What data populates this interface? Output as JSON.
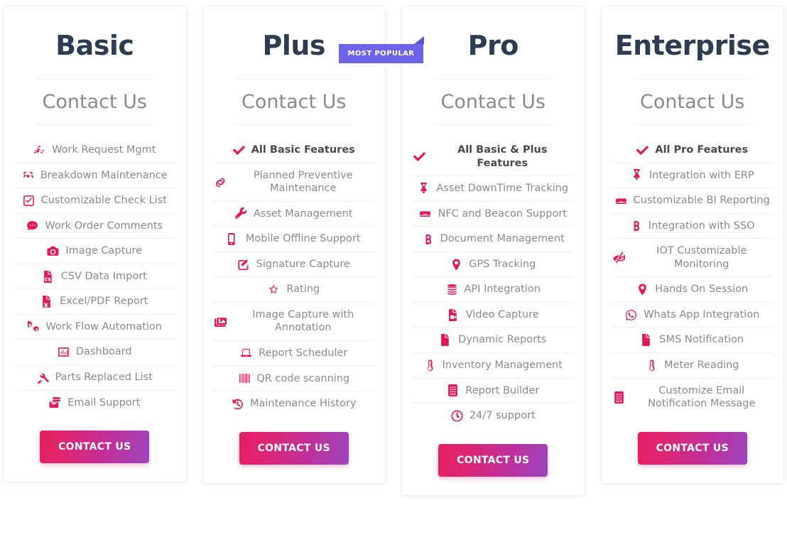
{
  "theme": {
    "accent_pink": "#e6175c",
    "badge_purple": "#6c63e8",
    "title_color": "#2e3c52",
    "muted_text": "#8b8b8f",
    "cta_gradient_from": "#e51f63",
    "cta_gradient_to": "#9b45bd"
  },
  "plans": [
    {
      "name": "Basic",
      "price_label": "Contact Us",
      "badge": null,
      "cta_label": "CONTACT US",
      "features": [
        {
          "label": "Work Request Mgmt",
          "icon": "cubes-icon",
          "headline": false
        },
        {
          "label": "Breakdown Maintenance",
          "icon": "broken-link-icon",
          "headline": false
        },
        {
          "label": "Customizable Check List",
          "icon": "check-square-icon",
          "headline": false
        },
        {
          "label": "Work Order Comments",
          "icon": "comment-dots-icon",
          "headline": false
        },
        {
          "label": "Image Capture",
          "icon": "camera-icon",
          "headline": false
        },
        {
          "label": "CSV Data Import",
          "icon": "file-csv-icon",
          "headline": false
        },
        {
          "label": "Excel/PDF Report",
          "icon": "file-excel-icon",
          "headline": false
        },
        {
          "label": "Work Flow Automation",
          "icon": "cogs-icon",
          "headline": false
        },
        {
          "label": "Dashboard",
          "icon": "chart-bar-icon",
          "headline": false
        },
        {
          "label": "Parts Replaced List",
          "icon": "wrench-screw-icon",
          "headline": false
        },
        {
          "label": "Email Support",
          "icon": "mail-bulk-icon",
          "headline": false
        }
      ]
    },
    {
      "name": "Plus",
      "price_label": "Contact Us",
      "badge": "MOST POPULAR",
      "cta_label": "CONTACT US",
      "features": [
        {
          "label": "All Basic Features",
          "icon": "check-icon",
          "headline": true
        },
        {
          "label": "Planned Preventive Maintenance",
          "icon": "link-icon",
          "headline": false
        },
        {
          "label": "Asset Management",
          "icon": "wrench-icon",
          "headline": false
        },
        {
          "label": "Mobile Offline Support",
          "icon": "mobile-icon",
          "headline": false
        },
        {
          "label": "Signature Capture",
          "icon": "edit-square-icon",
          "headline": false
        },
        {
          "label": "Rating",
          "icon": "star-icon",
          "headline": false
        },
        {
          "label": "Image Capture with Annotation",
          "icon": "images-icon",
          "headline": false
        },
        {
          "label": "Report Scheduler",
          "icon": "laptop-icon",
          "headline": false
        },
        {
          "label": "QR code scanning",
          "icon": "barcode-icon",
          "headline": false
        },
        {
          "label": "Maintenance History",
          "icon": "history-icon",
          "headline": false
        }
      ]
    },
    {
      "name": "Pro",
      "price_label": "Contact Us",
      "badge": null,
      "cta_label": "CONTACT US",
      "features": [
        {
          "label": "All Basic & Plus Features",
          "icon": "check-icon",
          "headline": true
        },
        {
          "label": "Asset DownTime Tracking",
          "icon": "hourglass-icon",
          "headline": false
        },
        {
          "label": "NFC and Beacon Support",
          "icon": "nfc-chip-icon",
          "headline": false
        },
        {
          "label": "Document Management",
          "icon": "dropbox-icon",
          "headline": false
        },
        {
          "label": "GPS Tracking",
          "icon": "map-marker-icon",
          "headline": false
        },
        {
          "label": "API Integration",
          "icon": "database-icon",
          "headline": false
        },
        {
          "label": "Video Capture",
          "icon": "file-video-icon",
          "headline": false
        },
        {
          "label": "Dynamic Reports",
          "icon": "file-icon",
          "headline": false
        },
        {
          "label": "Inventory Management",
          "icon": "thermometer-icon",
          "headline": false
        },
        {
          "label": "Report Builder",
          "icon": "building-icon",
          "headline": false
        },
        {
          "label": "24/7 support",
          "icon": "clock-icon",
          "headline": false
        }
      ]
    },
    {
      "name": "Enterprise",
      "price_label": "Contact Us",
      "badge": null,
      "cta_label": "CONTACT US",
      "features": [
        {
          "label": "All Pro Features",
          "icon": "check-icon",
          "headline": true
        },
        {
          "label": "Integration with ERP",
          "icon": "hourglass-icon",
          "headline": false
        },
        {
          "label": "Customizable BI Reporting",
          "icon": "nfc-chip-icon",
          "headline": false
        },
        {
          "label": "Integration with SSO",
          "icon": "dropbox-icon",
          "headline": false
        },
        {
          "label": "IOT Customizable Monitoring",
          "icon": "low-vision-icon",
          "headline": false
        },
        {
          "label": "Hands On Session",
          "icon": "map-marker-icon",
          "headline": false
        },
        {
          "label": "Whats App Integration",
          "icon": "whatsapp-icon",
          "headline": false
        },
        {
          "label": "SMS Notification",
          "icon": "file-icon",
          "headline": false
        },
        {
          "label": "Meter Reading",
          "icon": "thermometer-icon",
          "headline": false
        },
        {
          "label": "Customize Email Notification Message",
          "icon": "building-icon",
          "headline": false
        }
      ]
    }
  ]
}
